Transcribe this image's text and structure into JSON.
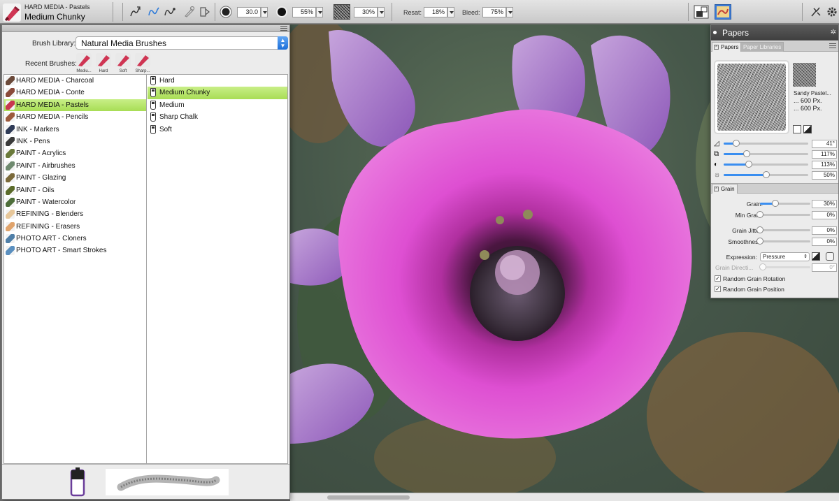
{
  "toolbar": {
    "brush_category": "HARD MEDIA - Pastels",
    "brush_variant": "Medium Chunky",
    "size_value": "30.0",
    "opacity_value": "55%",
    "grain_value": "30%",
    "resat_label": "Resat:",
    "resat_value": "18%",
    "bleed_label": "Bleed:",
    "bleed_value": "75%",
    "icons": [
      "brush-tracking-icon",
      "stroke-freehand-icon",
      "stroke-line-icon",
      "stylus-icon",
      "ruler-icon",
      "size-icon",
      "opacity-icon",
      "grain-texture-icon",
      "layers-icon",
      "paper-swatch-icon",
      "brush-controls-icon",
      "settings-icon"
    ]
  },
  "brush_library": {
    "library_label": "Brush Library:",
    "library_value": "Natural Media Brushes",
    "recent_label": "Recent Brushes:",
    "recent": [
      {
        "label": "Mediu..."
      },
      {
        "label": "Hard"
      },
      {
        "label": "Soft"
      },
      {
        "label": "Sharp..."
      }
    ],
    "categories": [
      {
        "label": "HARD MEDIA - Charcoal",
        "color": "#6b4a3a",
        "selected": false
      },
      {
        "label": "HARD MEDIA - Conte",
        "color": "#8a4a3a",
        "selected": false
      },
      {
        "label": "HARD MEDIA - Pastels",
        "color": "#c8384f",
        "selected": true
      },
      {
        "label": "HARD MEDIA - Pencils",
        "color": "#9c5a3c",
        "selected": false
      },
      {
        "label": "INK - Markers",
        "color": "#2f3b57",
        "selected": false
      },
      {
        "label": "INK - Pens",
        "color": "#3a3a3a",
        "selected": false
      },
      {
        "label": "PAINT - Acrylics",
        "color": "#6a7a3a",
        "selected": false
      },
      {
        "label": "PAINT - Airbrushes",
        "color": "#6f8a6f",
        "selected": false
      },
      {
        "label": "PAINT - Glazing",
        "color": "#7b6a3a",
        "selected": false
      },
      {
        "label": "PAINT - Oils",
        "color": "#5b6b2a",
        "selected": false
      },
      {
        "label": "PAINT - Watercolor",
        "color": "#4e6e3a",
        "selected": false
      },
      {
        "label": "REFINING - Blenders",
        "color": "#e7c79a",
        "selected": false
      },
      {
        "label": "REFINING - Erasers",
        "color": "#e0a36b",
        "selected": false
      },
      {
        "label": "PHOTO ART - Cloners",
        "color": "#4f7fa8",
        "selected": false
      },
      {
        "label": "PHOTO ART - Smart Strokes",
        "color": "#5a8fbf",
        "selected": false
      }
    ],
    "variants": [
      {
        "label": "Hard",
        "selected": false
      },
      {
        "label": "Medium Chunky",
        "selected": true
      },
      {
        "label": "Medium",
        "selected": false
      },
      {
        "label": "Sharp Chalk",
        "selected": false
      },
      {
        "label": "Soft",
        "selected": false
      }
    ]
  },
  "papers": {
    "title": "Papers",
    "tab_papers": "Papers",
    "tab_libraries": "Paper Libraries",
    "paper_name": "Sandy Pastel...",
    "paper_width": "... 600 Px.",
    "paper_height": "... 600 Px.",
    "sliders": [
      {
        "icon": "angle-icon",
        "value": "41°",
        "fraction": 0.15
      },
      {
        "icon": "scale-icon",
        "value": "117%",
        "fraction": 0.27
      },
      {
        "icon": "contrast-icon",
        "value": "113%",
        "fraction": 0.3
      },
      {
        "icon": "brightness-icon",
        "value": "50%",
        "fraction": 0.5
      }
    ],
    "grain_tab": "Grain",
    "grain_rows": [
      {
        "label": "Grain:",
        "value": "30%",
        "fraction": 0.3,
        "disabled": false
      },
      {
        "label": "Min Grain:",
        "value": "0%",
        "fraction": 0,
        "disabled": false
      },
      {
        "label": "Grain Jitter:",
        "value": "0%",
        "fraction": 0,
        "disabled": false
      },
      {
        "label": "Smoothness:",
        "value": "0%",
        "fraction": 0,
        "disabled": false
      }
    ],
    "expression_label": "Expression:",
    "expression_value": "Pressure",
    "direction_label": "Grain Directi...",
    "direction_value": "0°",
    "random_rotation": "Random Grain Rotation",
    "random_position": "Random Grain Position",
    "check_mark": "✓"
  },
  "colors": {
    "selection_green": "#b6e46a",
    "accent_blue": "#3a8ef0",
    "flower_pink": "#d94fd0"
  }
}
